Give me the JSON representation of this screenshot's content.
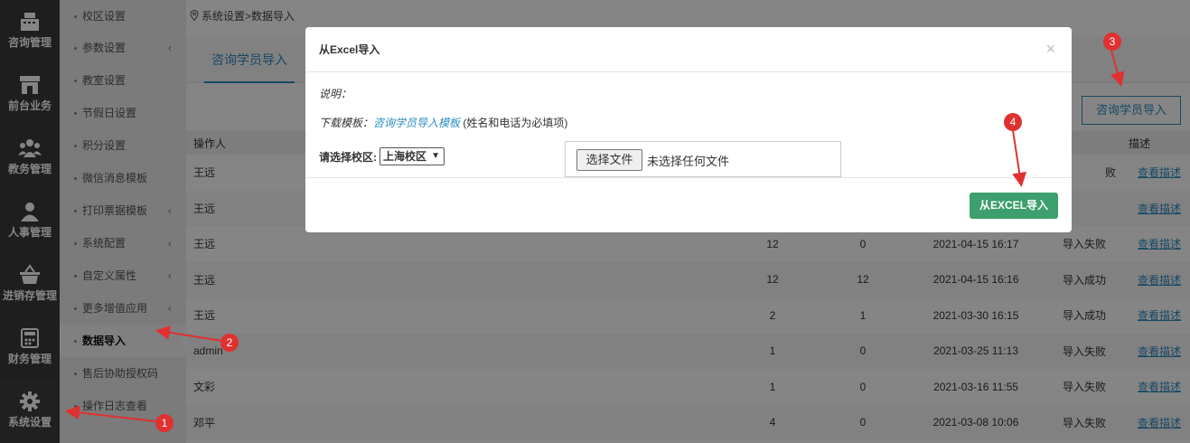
{
  "colors": {
    "accent": "#2d8cc0",
    "success": "#3c9f6d",
    "nav_bg": "#3a3a3a",
    "annotation": "#e03131"
  },
  "mainnav": {
    "items": [
      {
        "label": "咨询管理",
        "icon": "cash-register-icon"
      },
      {
        "label": "前台业务",
        "icon": "store-icon"
      },
      {
        "label": "教务管理",
        "icon": "group-icon"
      },
      {
        "label": "人事管理",
        "icon": "person-icon"
      },
      {
        "label": "进销存管理",
        "icon": "basket-icon"
      },
      {
        "label": "财务管理",
        "icon": "calculator-icon"
      },
      {
        "label": "系统设置",
        "icon": "gear-icon"
      }
    ]
  },
  "subnav": {
    "items": [
      {
        "label": "校区设置"
      },
      {
        "label": "参数设置"
      },
      {
        "label": "教室设置"
      },
      {
        "label": "节假日设置"
      },
      {
        "label": "积分设置"
      },
      {
        "label": "微信消息模板"
      },
      {
        "label": "打印票据模板"
      },
      {
        "label": "系统配置"
      },
      {
        "label": "自定义属性"
      },
      {
        "label": "更多增值应用"
      },
      {
        "label": "数据导入"
      },
      {
        "label": "售后协助授权码"
      },
      {
        "label": "操作日志查看"
      }
    ]
  },
  "breadcrumb": "系统设置>数据导入",
  "tabs": {
    "active": "咨询学员导入"
  },
  "import_button": "咨询学员导入",
  "table": {
    "headers": {
      "operator": "操作人",
      "desc": "描述"
    },
    "rows": [
      {
        "operator": "王远",
        "total": "",
        "success": "",
        "time": "",
        "status": "败",
        "link": "查看描述"
      },
      {
        "operator": "王远",
        "total": "",
        "success": "",
        "time": "",
        "status": "",
        "link": "查看描述"
      },
      {
        "operator": "王远",
        "total": "12",
        "success": "0",
        "time": "2021-04-15 16:17",
        "status": "导入失败",
        "link": "查看描述"
      },
      {
        "operator": "王远",
        "total": "12",
        "success": "12",
        "time": "2021-04-15 16:16",
        "status": "导入成功",
        "link": "查看描述"
      },
      {
        "operator": "王远",
        "total": "2",
        "success": "1",
        "time": "2021-03-30 16:15",
        "status": "导入成功",
        "link": "查看描述"
      },
      {
        "operator": "admin",
        "total": "1",
        "success": "0",
        "time": "2021-03-25 11:13",
        "status": "导入失败",
        "link": "查看描述"
      },
      {
        "operator": "文彩",
        "total": "1",
        "success": "0",
        "time": "2021-03-16 11:55",
        "status": "导入失败",
        "link": "查看描述"
      },
      {
        "operator": "邓平",
        "total": "4",
        "success": "0",
        "time": "2021-03-08 10:06",
        "status": "导入失败",
        "link": "查看描述"
      }
    ]
  },
  "modal": {
    "title": "从Excel导入",
    "close": "×",
    "desc_label": "说明：",
    "download_label": "下载模板：",
    "template_link": "咨询学员导入模板",
    "template_note": "(姓名和电话为必填项)",
    "campus_label": "请选择校区:",
    "campus_value": "上海校区",
    "file_button": "选择文件",
    "file_status": "未选择任何文件",
    "submit": "从EXCEL导入"
  },
  "annotations": [
    "1",
    "2",
    "3",
    "4"
  ]
}
